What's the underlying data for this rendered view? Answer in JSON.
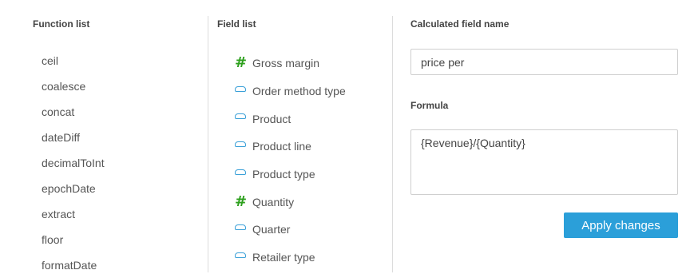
{
  "function_panel": {
    "heading": "Function list",
    "items": [
      "ceil",
      "coalesce",
      "concat",
      "dateDiff",
      "decimalToInt",
      "epochDate",
      "extract",
      "floor",
      "formatDate"
    ]
  },
  "field_panel": {
    "heading": "Field list",
    "items": [
      {
        "label": "Gross margin",
        "icon": "measure-hash-icon"
      },
      {
        "label": "Order method type",
        "icon": "dimension-tag-icon"
      },
      {
        "label": "Product",
        "icon": "dimension-tag-icon"
      },
      {
        "label": "Product line",
        "icon": "dimension-tag-icon"
      },
      {
        "label": "Product type",
        "icon": "dimension-tag-icon"
      },
      {
        "label": "Quantity",
        "icon": "measure-hash-icon"
      },
      {
        "label": "Quarter",
        "icon": "dimension-tag-icon"
      },
      {
        "label": "Retailer type",
        "icon": "dimension-tag-icon"
      }
    ]
  },
  "editor": {
    "name_label": "Calculated field name",
    "name_value": "price per",
    "formula_label": "Formula",
    "formula_value": "{Revenue}/{Quantity}",
    "apply_label": "Apply changes"
  },
  "colors": {
    "measure_icon": "#2ea01e",
    "dimension_icon": "#3aa0d8",
    "apply_button": "#2b9fd9"
  }
}
